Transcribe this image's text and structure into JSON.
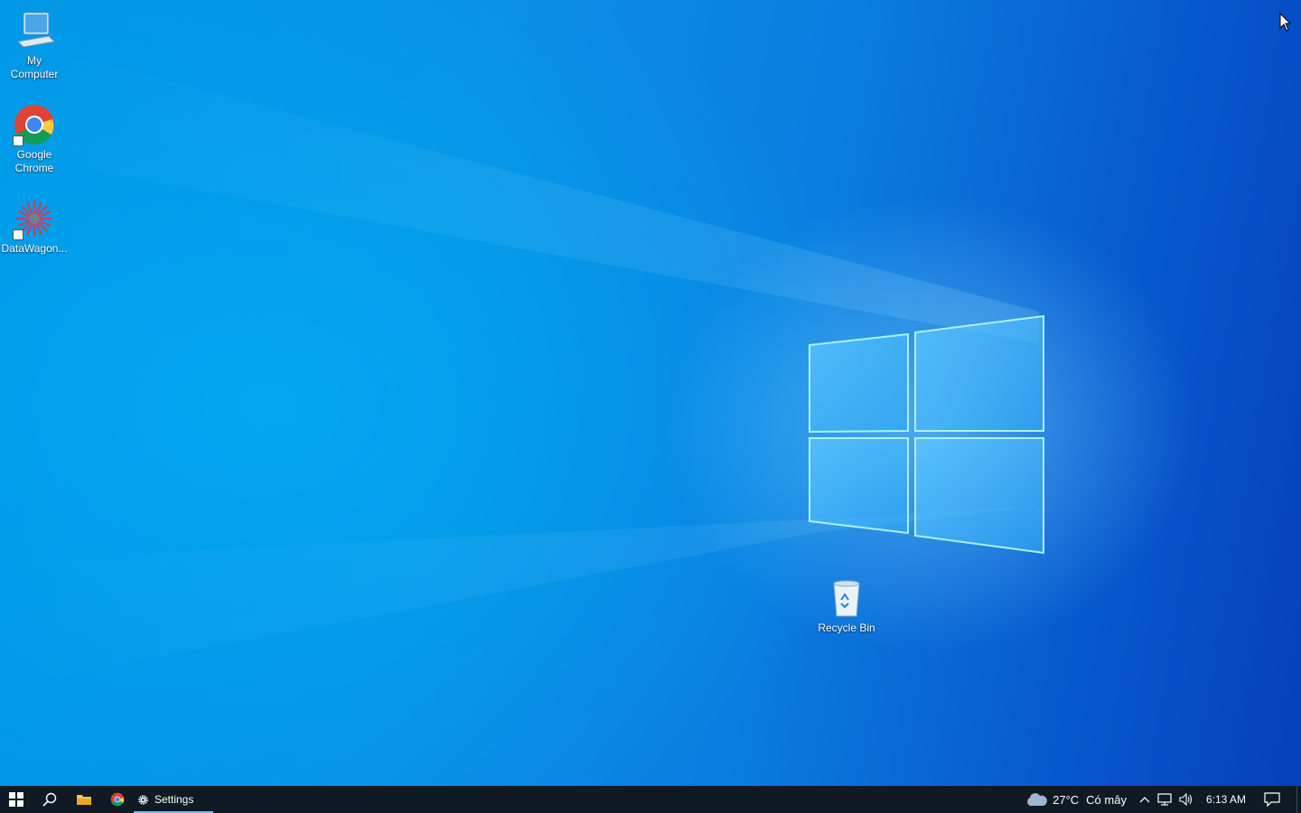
{
  "desktop": {
    "icons": [
      {
        "label": "My\nComputer"
      },
      {
        "label": "Google\nChrome"
      },
      {
        "label": "DataWagon..."
      },
      {
        "label": "Recycle Bin"
      }
    ]
  },
  "taskbar": {
    "active_app_label": "Settings",
    "weather_temp": "27°C",
    "weather_desc": "Có mây",
    "clock": "6:13 AM"
  },
  "colors": {
    "taskbar_bg": "#0f1a24",
    "active_underline": "#76b9ed"
  }
}
